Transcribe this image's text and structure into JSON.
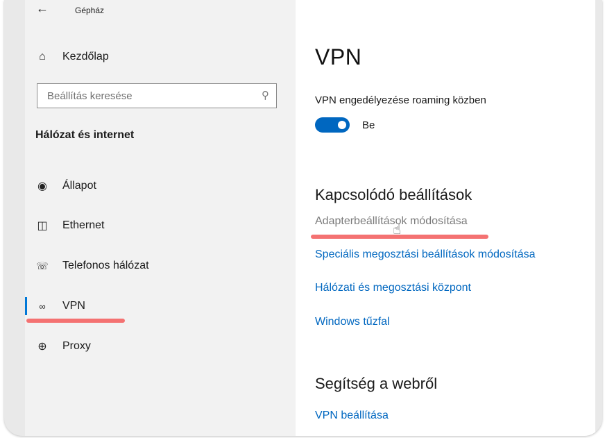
{
  "window": {
    "back_icon": "back-arrow-icon",
    "title": "Gépház"
  },
  "sidebar": {
    "home": {
      "icon": "home-icon",
      "label": "Kezdőlap"
    },
    "search": {
      "placeholder": "Beállítás keresése",
      "icon": "search-icon"
    },
    "section_title": "Hálózat és internet",
    "items": [
      {
        "icon": "globe-status-icon",
        "label": "Állapot"
      },
      {
        "icon": "ethernet-icon",
        "label": "Ethernet"
      },
      {
        "icon": "dialup-icon",
        "label": "Telefonos hálózat"
      },
      {
        "icon": "vpn-icon",
        "label": "VPN",
        "selected": true
      },
      {
        "icon": "globe-icon",
        "label": "Proxy"
      }
    ]
  },
  "main": {
    "title": "VPN",
    "roaming_label": "VPN engedélyezése roaming közben",
    "roaming_toggle": {
      "state": "Be",
      "on": true
    },
    "related_heading": "Kapcsolódó beállítások",
    "related_links": [
      "Adapterbeállítások módosítása",
      "Speciális megosztási beállítások módosítása",
      "Hálózati és megosztási központ",
      "Windows tűzfal"
    ],
    "help_heading": "Segítség a webről",
    "help_links": [
      "VPN beállítása"
    ]
  },
  "colors": {
    "accent": "#0067c0",
    "highlight_underline": "#f47272",
    "sidebar_bg": "#f2f2f2"
  }
}
